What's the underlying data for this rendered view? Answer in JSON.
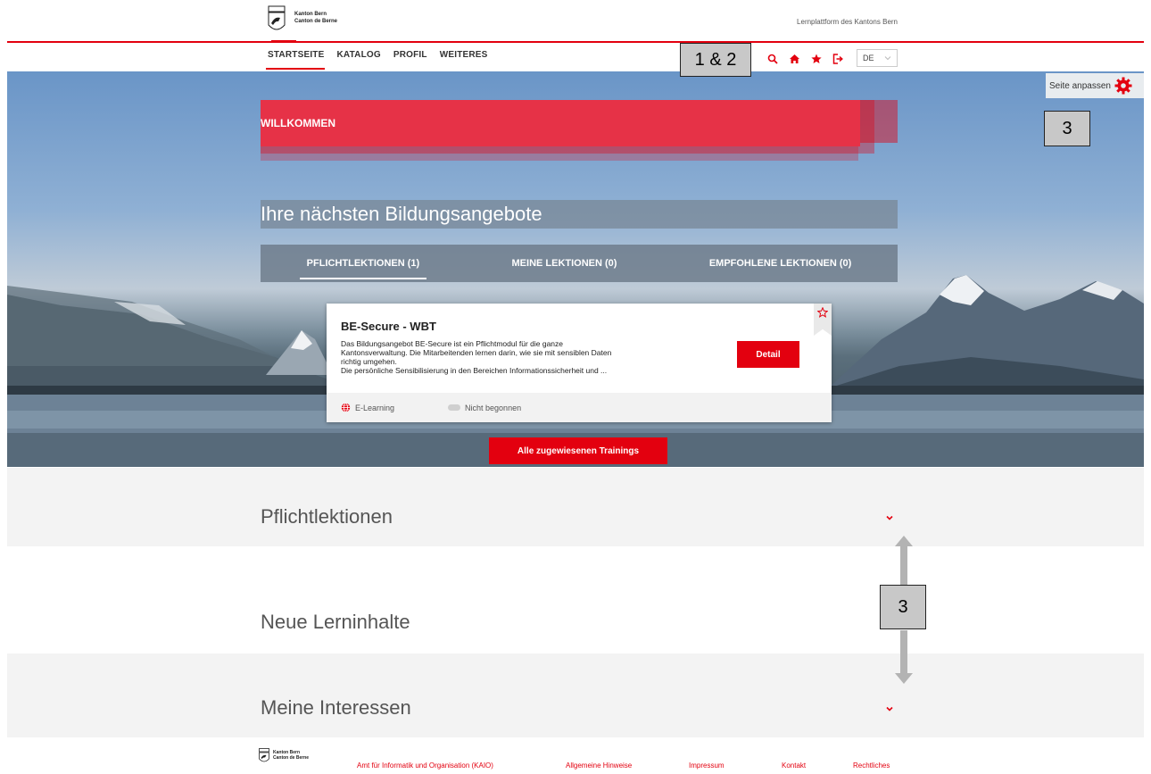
{
  "header": {
    "logo_line1": "Kanton Bern",
    "logo_line2": "Canton de Berne",
    "platform_name": "Lernplattform des Kantons Bern"
  },
  "nav": {
    "items": [
      "STARTSEITE",
      "KATALOG",
      "PROFIL",
      "WEITERES"
    ],
    "active": "STARTSEITE"
  },
  "tools": {
    "icons": [
      "search-icon",
      "home-icon",
      "star-icon",
      "logout-icon"
    ],
    "language": "DE"
  },
  "callouts": {
    "top": "1 & 2",
    "right": "3",
    "middle": "3"
  },
  "customize": {
    "label": "Seite anpassen"
  },
  "hero": {
    "welcome": "WILLKOMMEN",
    "offers_title": "Ihre nächsten Bildungsangebote",
    "tabs": [
      "PFLICHTLEKTIONEN (1)",
      "MEINE LEKTIONEN (0)",
      "EMPFOHLENE LEKTIONEN (0)"
    ],
    "active_tab": 0
  },
  "card": {
    "title": "BE-Secure - WBT",
    "line1": "Das Bildungsangebot BE-Secure ist ein Pflichtmodul für die ganze",
    "line2": "Kantonsverwaltung. Die Mitarbeitenden lernen darin, wie sie mit sensiblen Daten",
    "line3": "richtig umgehen.",
    "line4": "Die persönliche Sensibilisierung in den Bereichen Informationssicherheit und ...",
    "detail_label": "Detail",
    "type_label": "E-Learning",
    "status_label": "Nicht begonnen"
  },
  "all_trainings_label": "Alle zugewiesenen Trainings",
  "sections": {
    "pflicht": "Pflichtlektionen",
    "neue": "Neue Lerninhalte",
    "interessen": "Meine Interessen"
  },
  "footer": {
    "logo_line1": "Kanton Bern",
    "logo_line2": "Canton de Berne",
    "links": [
      "Amt für Informatik und Organisation (KAIO)",
      "Allgemeine Hinweise",
      "Impressum",
      "Kontakt",
      "Rechtliches"
    ]
  },
  "colors": {
    "brand_red": "#e3000f"
  }
}
